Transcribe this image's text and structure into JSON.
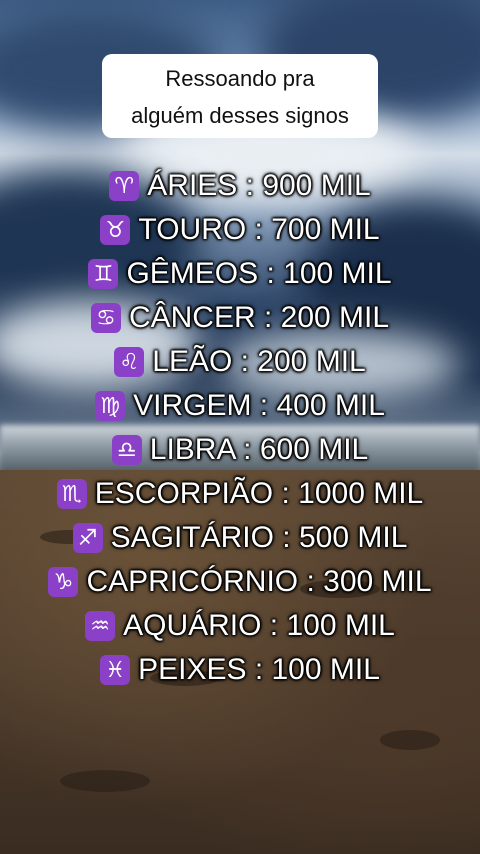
{
  "caption": {
    "line1": "Ressoando pra",
    "line2": "alguém desses signos"
  },
  "signs": [
    {
      "symbol": "♈",
      "icon": "aries-icon",
      "text": "ÁRIES :  900 MIL"
    },
    {
      "symbol": "♉",
      "icon": "taurus-icon",
      "text": "TOURO : 700 MIL"
    },
    {
      "symbol": "♊",
      "icon": "gemini-icon",
      "text": "GÊMEOS : 100 MIL"
    },
    {
      "symbol": "♋",
      "icon": "cancer-icon",
      "text": "CÂNCER : 200 MIL"
    },
    {
      "symbol": "♌",
      "icon": "leo-icon",
      "text": "LEÃO : 200 MIL"
    },
    {
      "symbol": "♍",
      "icon": "virgo-icon",
      "text": "VIRGEM : 400 MIL"
    },
    {
      "symbol": "♎",
      "icon": "libra-icon",
      "text": "LIBRA : 600 MIL"
    },
    {
      "symbol": "♏",
      "icon": "scorpio-icon",
      "text": "ESCORPIÃO : 1000 MIL"
    },
    {
      "symbol": "♐",
      "icon": "sagittarius-icon",
      "text": "SAGITÁRIO : 500 MIL"
    },
    {
      "symbol": "♑",
      "icon": "capricorn-icon",
      "text": "CAPRICÓRNIO : 300 MIL"
    },
    {
      "symbol": "♒",
      "icon": "aquarius-icon",
      "text": "AQUÁRIO : 100 MIL"
    },
    {
      "symbol": "♓",
      "icon": "pisces-icon",
      "text": "PEIXES : 100 MIL"
    }
  ],
  "colors": {
    "icon_bg": "#8a40c7",
    "text": "#ffffff"
  }
}
